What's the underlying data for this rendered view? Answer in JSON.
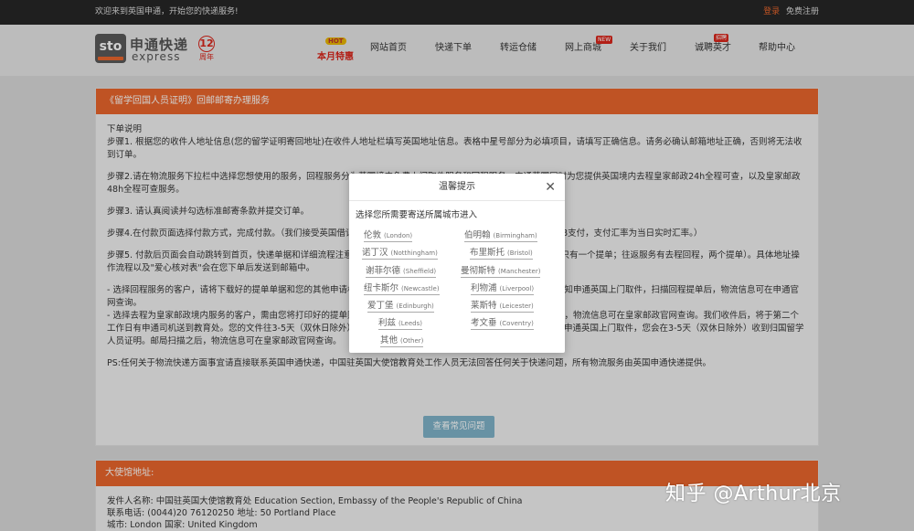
{
  "topbar": {
    "welcome": "欢迎来到英国申通，开始您的快递服务!",
    "login": "登录",
    "register": "免费注册"
  },
  "logo": {
    "mark": "sto",
    "cn": "申通快递",
    "en": "express",
    "years": "12",
    "years_suffix": "周年"
  },
  "promo": {
    "badge": "HOT",
    "label": "本月特惠"
  },
  "nav": {
    "items": [
      {
        "label": "网站首页"
      },
      {
        "label": "快递下单"
      },
      {
        "label": "转运仓储"
      },
      {
        "label": "网上商城",
        "badge": "NEW"
      },
      {
        "label": "关于我们"
      },
      {
        "label": "诚聘英才",
        "badge": "招聘"
      },
      {
        "label": "帮助中心"
      }
    ]
  },
  "panel": {
    "title": "《留学回国人员证明》回邮邮寄办理服务",
    "intro": "下单说明",
    "step1": "步骤1. 根据您的收件人地址信息(您的留学证明寄回地址)在收件人地址栏填写英国地址信息。表格中星号部分为必填项目，请填写正确信息。请务必确认邮箱地址正确，否则将无法收到订单。",
    "step2": "步骤2.请在物流服务下拉栏中选择您想使用的服务，回程服务分为英国境内免费上门取件服务和回程服务。申通英国同时为您提供英国境内去程皇家邮政24h全程可查，以及皇家邮政48h全程可查服务。",
    "step3": "步骤3. 请认真阅读并勾选标准邮寄条款并提交订单。",
    "step4": "步骤4.在付款页面选择付款方式，完成付款。（我们接受英国借记卡、信用卡和贝宝paypal付款，同时也接受支付宝RMB支付，支付汇率为当日实时汇率。）",
    "step5": "步骤5. 付款后页面会自动跳转到首页，快递单据和详细流程注意事项会发送到您的邮箱，以及您的快递单号，回程服务只有一个提单；往返服务有去程回程，两个提单）。具体地址操作流程以及\"爱心核对表\"会在您下单后发送到邮箱中。",
    "note1": "- 选择回程服务的客户，请将下载好的提单单据和您的其他申请材料一起提交给教育处，教育处审核您的材料通过后会通知申通英国上门取件，扫描回程提单后，物流信息可在申通官网查询。",
    "note2": "- 选择去程为皇家邮政境内服务的客户，需由您将打印好的提单贴在包裹上，投递到任意邮局扫描邮寄。邮局当场扫描后，物流信息可在皇家邮政官网查询。我们收件后，将于第二个工作日有申通司机送到教育处。您的文件往3-5天（双休日除外）可抵达驻英大使馆，教育处审核您的材料通过后会通知申通英国上门取件，您会在3-5天（双休日除外）收到归国留学人员证明。邮局扫描之后，物流信息可在皇家邮政官网查询。",
    "ps": "PS:任何关于物流快递方面事宜请直接联系英国申通快递，中国驻英国大使馆教育处工作人员无法回答任何关于快递问题，所有物流服务由英国申通快递提供。",
    "faq_button": "查看常见问题"
  },
  "embassy": {
    "title": "大使馆地址:",
    "sender_label": "发件人名称:",
    "sender": "中国驻英国大使馆教育处 Education Section, Embassy of the People's Republic of China",
    "phone_label": "联系电话:",
    "phone": "(0044)20 76120250",
    "address_label": "地址:",
    "address": "50 Portland Place",
    "city_label": "城市:",
    "city": "London",
    "country_label": "国家:",
    "country": "United Kingdom"
  },
  "modal": {
    "title": "温馨提示",
    "subtitle": "选择您所需要寄送所属城市进入",
    "cities": [
      {
        "cn": "伦敦",
        "en": "(London)"
      },
      {
        "cn": "伯明翰",
        "en": "(Birmingham)"
      },
      {
        "cn": "诺丁汉",
        "en": "(Notthingham)"
      },
      {
        "cn": "布里斯托",
        "en": "(Bristol)"
      },
      {
        "cn": "谢菲尔德",
        "en": "(Sheffield)"
      },
      {
        "cn": "曼彻斯特",
        "en": "(Manchester)"
      },
      {
        "cn": "纽卡斯尔",
        "en": "(Newcastle)"
      },
      {
        "cn": "利物浦",
        "en": "(Liverpool)"
      },
      {
        "cn": "爱丁堡",
        "en": "(Edinburgh)"
      },
      {
        "cn": "莱斯特",
        "en": "(Leicester)"
      },
      {
        "cn": "利兹",
        "en": "(Leeds)"
      },
      {
        "cn": "考文垂",
        "en": "(Coventry)"
      },
      {
        "cn": "其他",
        "en": "(Other)"
      }
    ]
  },
  "watermark": "知乎 @Arthur北京",
  "colors": {
    "accent": "#e9662c",
    "topbar": "#262626",
    "button": "#7fb3c9"
  }
}
